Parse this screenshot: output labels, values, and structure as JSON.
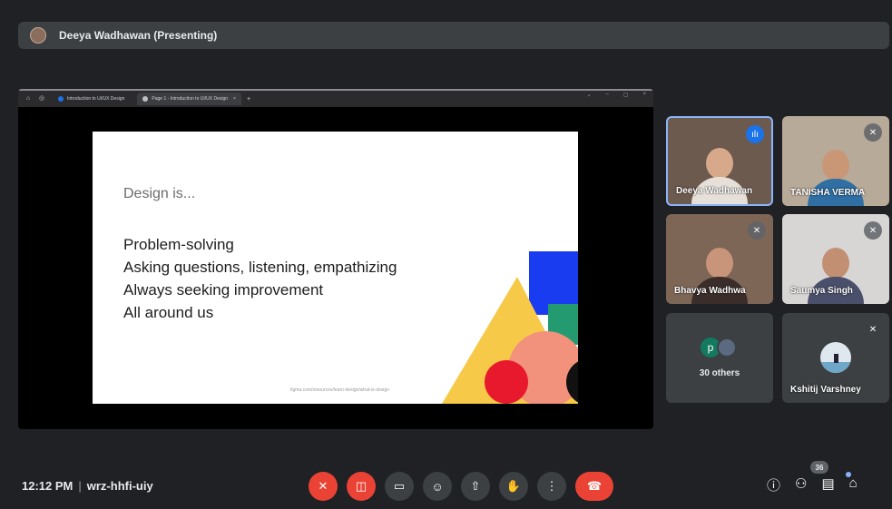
{
  "presenter_bar": {
    "title": "Deeya Wadhawan (Presenting)"
  },
  "browser": {
    "tabs": [
      {
        "label": "Introduction to UI/UX Design"
      },
      {
        "label": "Page 1 - Introduction to UI/UX Design"
      }
    ],
    "close_glyph": "×",
    "new_tab_glyph": "+",
    "window_controls": [
      "⌄",
      "–",
      "▢",
      "×"
    ]
  },
  "slide": {
    "heading": "Design is...",
    "lines": [
      "Problem-solving",
      "Asking questions, listening, empathizing",
      "Always seeking improvement",
      "All around us"
    ],
    "source": "figma.com/resources/learn-design/what-is-design"
  },
  "participants": [
    {
      "name": "Deeya Wadhawan",
      "status_icon": "speaking-icon"
    },
    {
      "name": "TANISHA VERMA",
      "status_icon": "mic-off-icon"
    },
    {
      "name": "Bhavya Wadhwa",
      "status_icon": "mic-off-icon"
    },
    {
      "name": "Saumya Singh",
      "status_icon": "mic-off-icon"
    },
    {
      "name": "30 others",
      "avatar_letter": "p"
    },
    {
      "name": "Kshitij Varshney",
      "status_icon": "mic-off-icon"
    }
  ],
  "meeting": {
    "time": "12:12 PM",
    "separator": "|",
    "code": "wrz-hhfi-uiy",
    "participant_count": "36"
  },
  "controls": {
    "mic": "mic-off-icon",
    "camera": "camera-off-icon",
    "captions": "captions-icon",
    "emoji": "emoji-icon",
    "present": "present-icon",
    "hand": "raise-hand-icon",
    "more": "more-vert-icon",
    "end_call": "end-call-icon"
  },
  "colors": {
    "background": "#202124",
    "tile": "#3c4043",
    "danger": "#ea4335",
    "speaking": "#1a73e8"
  }
}
